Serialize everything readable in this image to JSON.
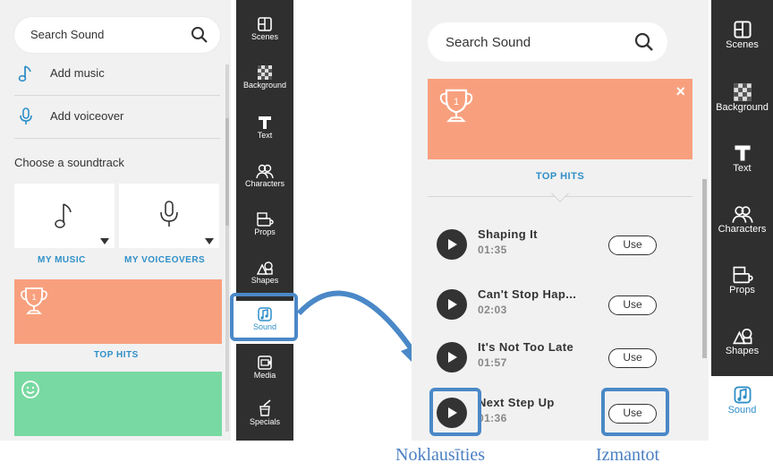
{
  "left": {
    "search": {
      "placeholder": "Search Sound"
    },
    "add_music": "Add music",
    "add_voiceover": "Add voiceover",
    "choose_label": "Choose a soundtrack",
    "cards": [
      {
        "label": "MY MUSIC",
        "icon": "music-note-icon"
      },
      {
        "label": "MY VOICEOVERS",
        "icon": "microphone-icon"
      }
    ],
    "top_hits_label": "TOP HITS"
  },
  "toolbar": {
    "items": [
      {
        "label": "Scenes",
        "icon": "scenes-icon"
      },
      {
        "label": "Background",
        "icon": "background-icon"
      },
      {
        "label": "Text",
        "icon": "text-icon"
      },
      {
        "label": "Characters",
        "icon": "characters-icon"
      },
      {
        "label": "Props",
        "icon": "props-icon"
      },
      {
        "label": "Shapes",
        "icon": "shapes-icon"
      },
      {
        "label": "Sound",
        "icon": "sound-icon"
      },
      {
        "label": "Media",
        "icon": "media-icon"
      },
      {
        "label": "Specials",
        "icon": "specials-icon"
      }
    ],
    "active": "Sound"
  },
  "right": {
    "search": {
      "placeholder": "Search Sound"
    },
    "close": "×",
    "top_hits_label": "TOP HITS",
    "tracks": [
      {
        "name": "Shaping It",
        "time": "01:35",
        "use": "Use"
      },
      {
        "name": "Can't Stop Hap...",
        "time": "02:03",
        "use": "Use"
      },
      {
        "name": "It's Not Too Late",
        "time": "01:57",
        "use": "Use"
      },
      {
        "name": "Next Step Up",
        "time": "01:36",
        "use": "Use"
      }
    ]
  },
  "captions": {
    "listen": "Noklausīties",
    "use": "Izmantot"
  },
  "colors": {
    "accent": "#2f8fc8",
    "highlight": "#4a88c7",
    "orange": "#f8a07e",
    "green": "#79d9a2",
    "toolbar": "#2f2f2f"
  }
}
